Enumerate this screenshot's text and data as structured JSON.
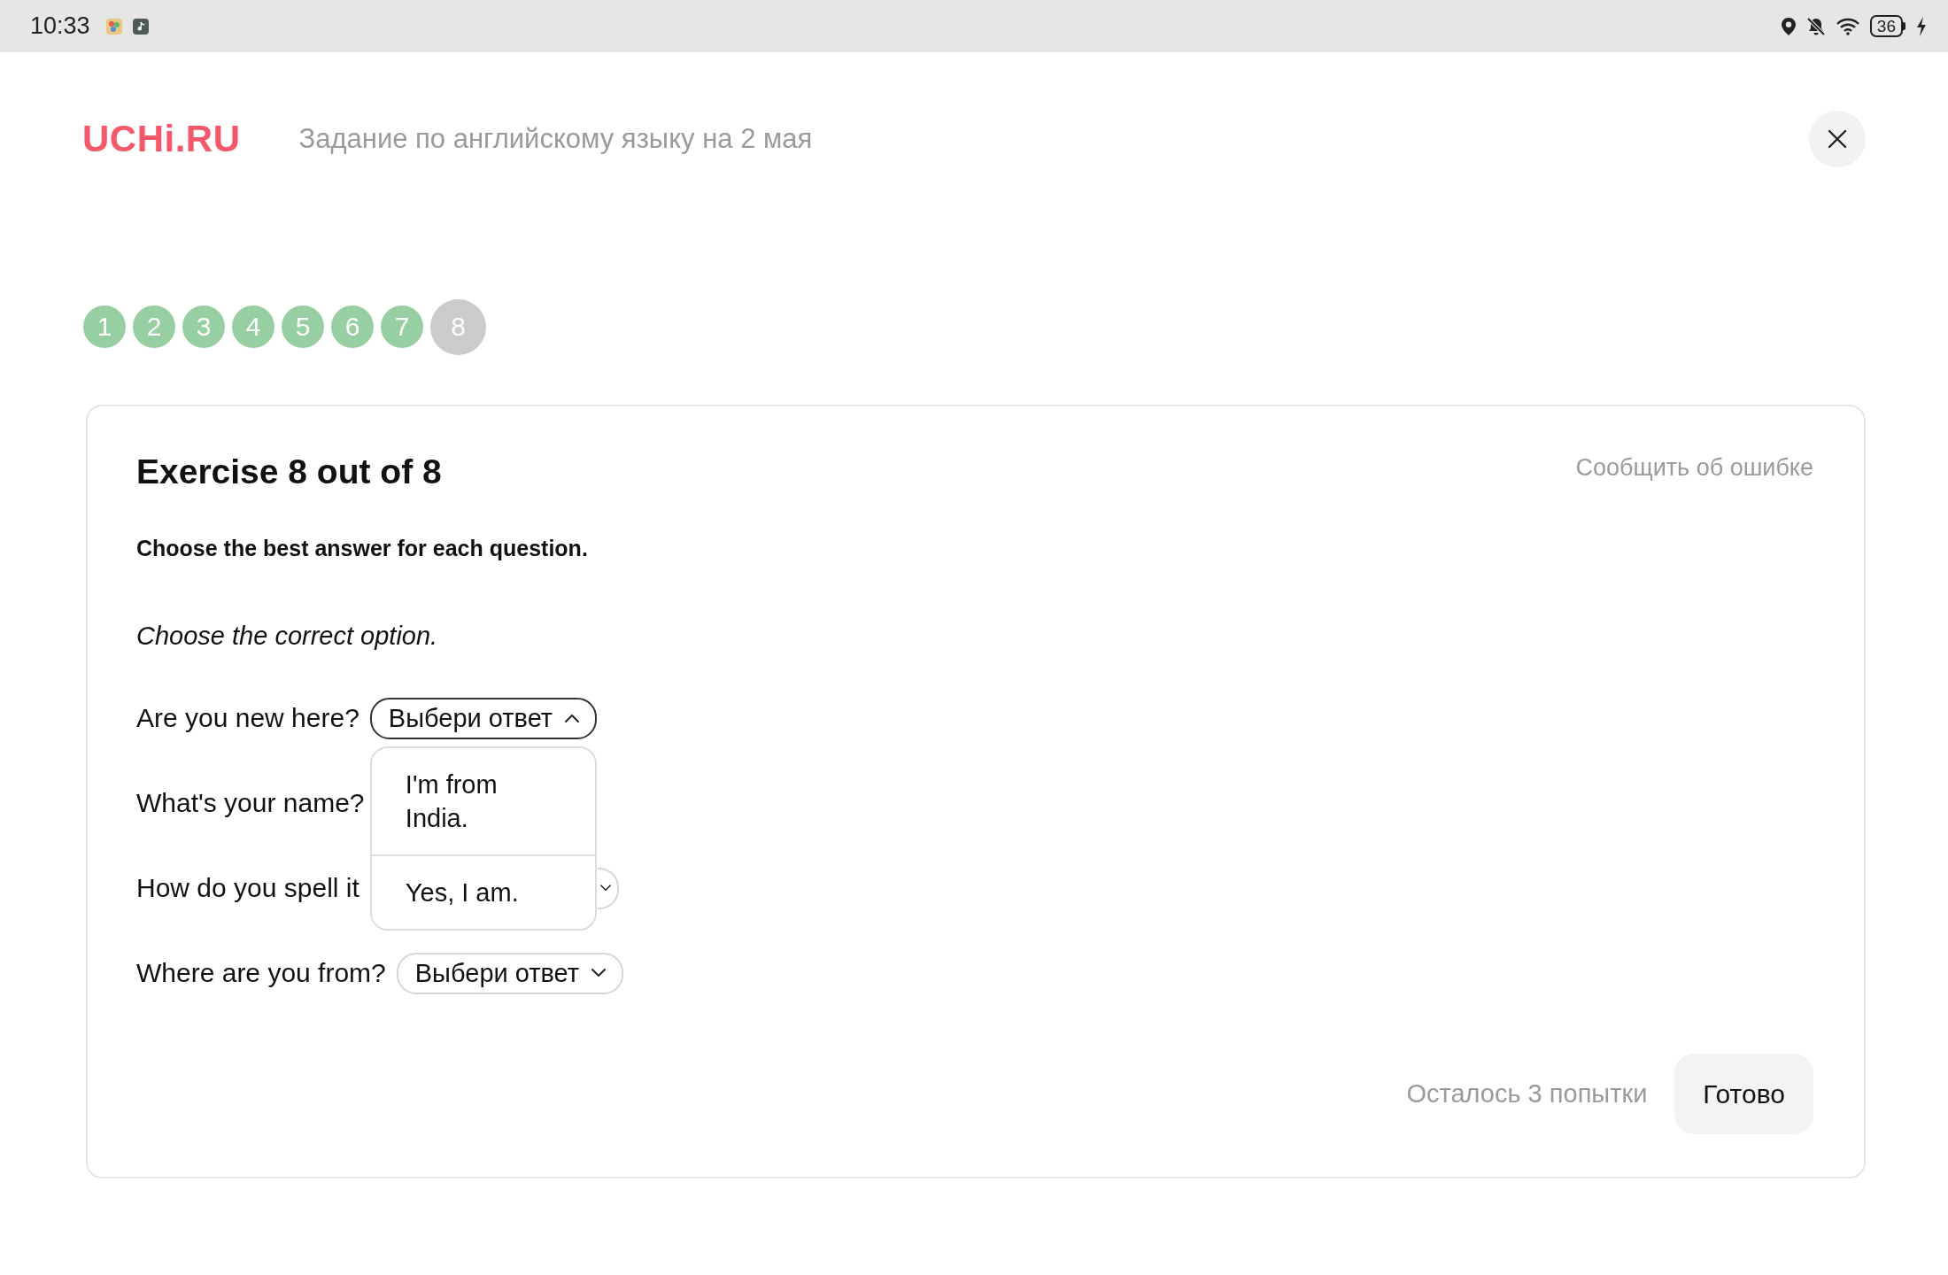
{
  "status_bar": {
    "time": "10:33",
    "battery": "36"
  },
  "header": {
    "logo": "UCHi.RU",
    "title": "Задание по английскому языку на 2 мая"
  },
  "steps": [
    {
      "label": "1",
      "selected": false
    },
    {
      "label": "2",
      "selected": false
    },
    {
      "label": "3",
      "selected": false
    },
    {
      "label": "4",
      "selected": false
    },
    {
      "label": "5",
      "selected": false
    },
    {
      "label": "6",
      "selected": false
    },
    {
      "label": "7",
      "selected": false
    },
    {
      "label": "8",
      "selected": true
    }
  ],
  "exercise": {
    "title": "Exercise 8 out of 8",
    "report_link": "Сообщить об ошибке",
    "instruction": "Choose the best answer for each question.",
    "hint": "Choose the correct option.",
    "questions": [
      {
        "text": "Are you new here?",
        "select": {
          "placeholder": "Выбери ответ",
          "open": true,
          "options": [
            {
              "label": "I'm from India.",
              "selected": false
            },
            {
              "label": "Yes, I am.",
              "selected": false
            }
          ]
        }
      },
      {
        "text": "What's your name?"
      },
      {
        "text": "How do you spell it",
        "select": {
          "open": false
        }
      },
      {
        "text": "Where are you from?",
        "select": {
          "placeholder": "Выбери ответ",
          "open": false
        }
      }
    ],
    "attempts_left": "Осталось 3 попытки",
    "done_button": "Готово"
  }
}
